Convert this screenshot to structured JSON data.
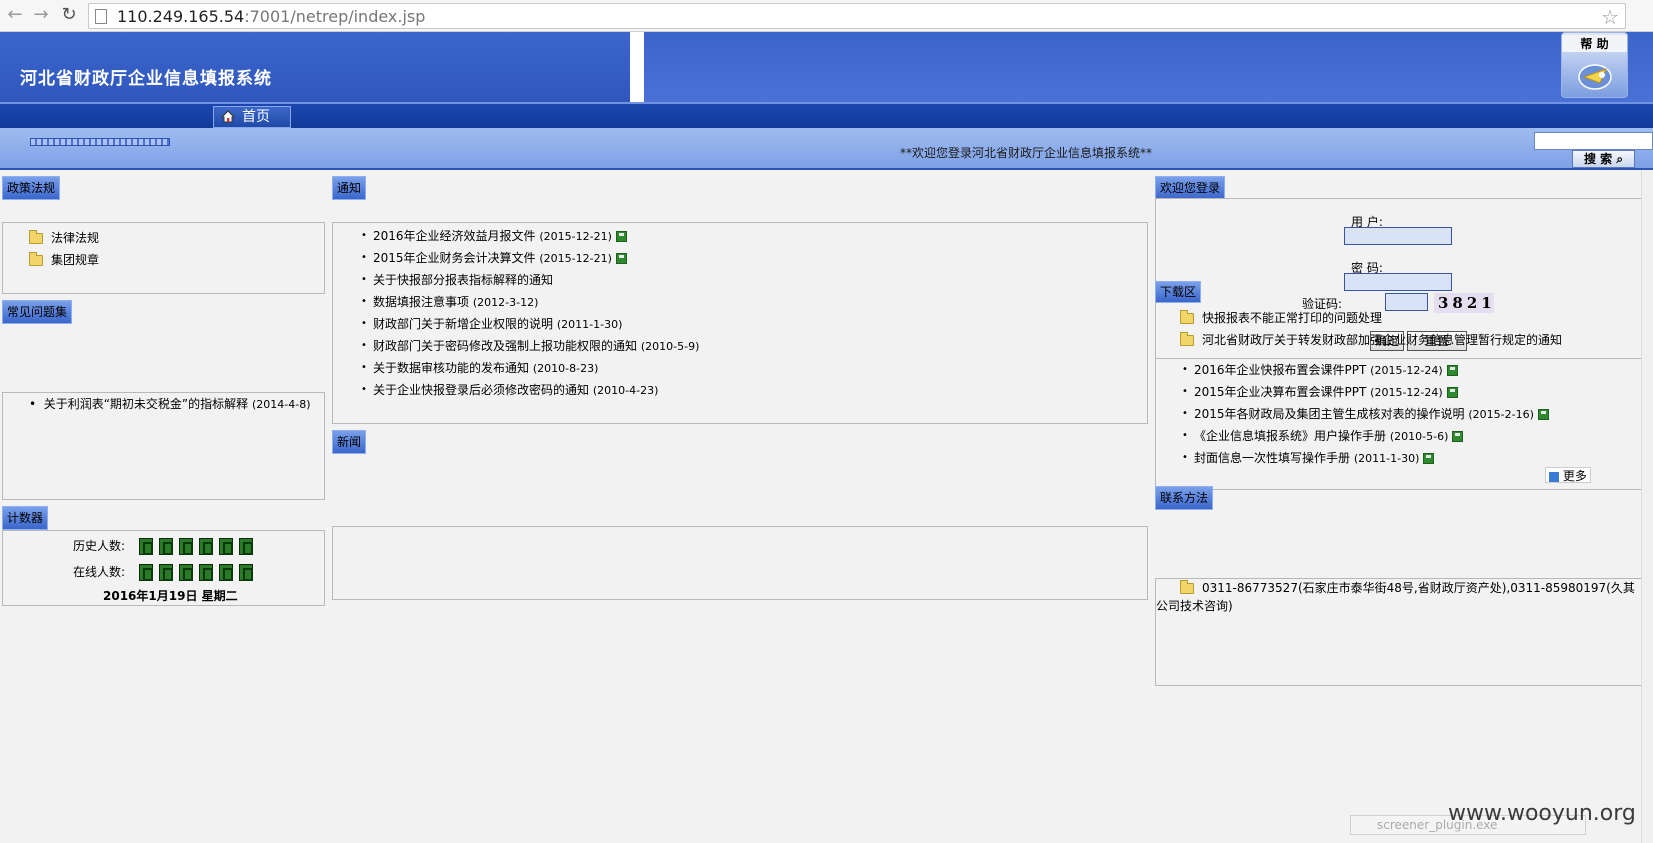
{
  "browser": {
    "url_host": "110.249.165.54",
    "url_rest": ":7001/netrep/index.jsp"
  },
  "header": {
    "site_title": "河北省财政厅企业信息填报系统",
    "help_label": "帮 助"
  },
  "nav": {
    "home_label": "首页"
  },
  "subbar": {
    "welcome": "**欢迎您登录河北省财政厅企业信息填报系统**",
    "search_label": "搜 索"
  },
  "policy": {
    "title": "政策法规",
    "items": [
      "法律法规",
      "集团规章"
    ]
  },
  "faq": {
    "title": "常见问题集",
    "items": [
      {
        "text": "关于利润表“期初未交税金”的指标解释",
        "date": "(2014-4-8)"
      }
    ]
  },
  "counter": {
    "title": "计数器",
    "history_label": "历史人数:",
    "online_label": "在线人数:",
    "date": "2016年1月19日  星期二"
  },
  "notice": {
    "title": "通知",
    "items": [
      {
        "text": "2016年企业经济效益月报文件",
        "date": "(2015-12-21)",
        "attach": true
      },
      {
        "text": "2015年企业财务会计决算文件",
        "date": "(2015-12-21)",
        "attach": true
      },
      {
        "text": "关于快报部分报表指标解释的通知",
        "date": "",
        "attach": false
      },
      {
        "text": "数据填报注意事项",
        "date": "(2012-3-12)",
        "attach": false
      },
      {
        "text": "财政部门关于新增企业权限的说明",
        "date": "(2011-1-30)",
        "attach": false
      },
      {
        "text": "财政部门关于密码修改及强制上报功能权限的通知",
        "date": "(2010-5-9)",
        "attach": false
      },
      {
        "text": "关于数据审核功能的发布通知",
        "date": "(2010-8-23)",
        "attach": false
      },
      {
        "text": "关于企业快报登录后必须修改密码的通知",
        "date": "(2010-4-23)",
        "attach": false
      }
    ]
  },
  "news": {
    "title": "新闻"
  },
  "login": {
    "title": "欢迎您登录",
    "user_label": "用    户:",
    "password_label": "密    码:",
    "captcha_label": "验证码:",
    "captcha_code": "3821",
    "confirm_label": "确定",
    "reset_label": "重置"
  },
  "download": {
    "title": "下载区",
    "folders": [
      "快报报表不能正常打印的问题处理",
      "河北省财政厅关于转发财政部加强企业财务信息管理暂行规定的通知"
    ],
    "items": [
      {
        "text": "2016年企业快报布置会课件PPT",
        "date": "(2015-12-24)"
      },
      {
        "text": "2015年企业决算布置会课件PPT",
        "date": "(2015-12-24)"
      },
      {
        "text": "2015年各财政局及集团主管生成核对表的操作说明",
        "date": "(2015-2-16)"
      },
      {
        "text": "《企业信息填报系统》用户操作手册",
        "date": "(2010-5-6)"
      },
      {
        "text": "封面信息一次性填写操作手册",
        "date": "(2011-1-30)"
      }
    ],
    "more_label": "更多"
  },
  "contact": {
    "title": "联系方法",
    "line1": "0311-86773527(石家庄市泰华街48号,省财政厅资产处),0311-85980197(久其",
    "line2": "公司技术咨询)"
  },
  "overlay": {
    "watermark": "www.wooyun.org",
    "screener": "screener_plugin.exe"
  }
}
